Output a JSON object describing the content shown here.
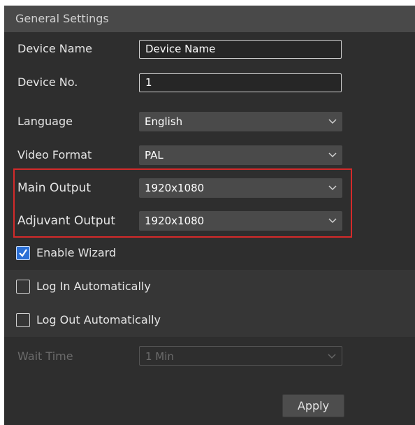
{
  "header": {
    "title": "General Settings"
  },
  "fields": {
    "device_name": {
      "label": "Device Name",
      "value": "Device Name"
    },
    "device_no": {
      "label": "Device No.",
      "value": "1"
    },
    "language": {
      "label": "Language",
      "value": "English"
    },
    "video_format": {
      "label": "Video Format",
      "value": "PAL"
    },
    "main_output": {
      "label": "Main Output",
      "value": "1920x1080"
    },
    "adjuvant_output": {
      "label": "Adjuvant Output",
      "value": "1920x1080"
    }
  },
  "checkboxes": {
    "enable_wizard": {
      "label": "Enable Wizard",
      "checked": true
    },
    "log_in_auto": {
      "label": "Log In Automatically",
      "checked": false
    },
    "log_out_auto": {
      "label": "Log Out Automatically",
      "checked": false
    }
  },
  "wait_time": {
    "label": "Wait Time",
    "value": "1 Min",
    "disabled": true
  },
  "buttons": {
    "apply": "Apply"
  },
  "colors": {
    "highlight": "#d42a2a",
    "checkbox_accent": "#2a6fd6",
    "panel_bg": "#2e2e2e",
    "header_bg": "#494949"
  }
}
